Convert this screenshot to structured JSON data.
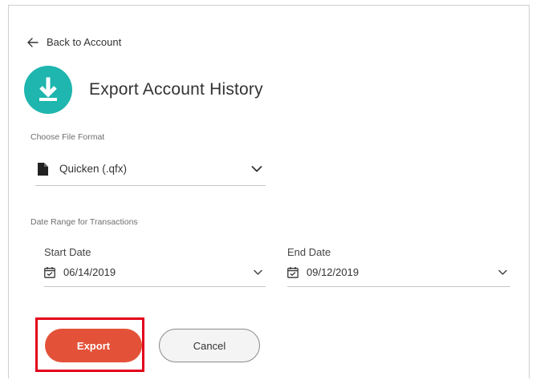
{
  "back_link": {
    "label": "Back to Account"
  },
  "page": {
    "title": "Export Account History"
  },
  "file_format": {
    "section_label": "Choose File Format",
    "selected": "Quicken (.qfx)"
  },
  "date_range": {
    "section_label": "Date Range for Transactions",
    "start": {
      "label": "Start Date",
      "value": "06/14/2019"
    },
    "end": {
      "label": "End Date",
      "value": "09/12/2019"
    }
  },
  "actions": {
    "export_label": "Export",
    "cancel_label": "Cancel"
  },
  "colors": {
    "accent_teal": "#1eb6ae",
    "export_orange": "#e35238",
    "highlight_red": "#e3001b"
  }
}
